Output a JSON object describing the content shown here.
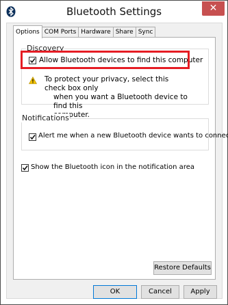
{
  "window": {
    "title": "Bluetooth Settings",
    "close_glyph": "✕"
  },
  "tabs": [
    "Options",
    "COM Ports",
    "Hardware",
    "Share",
    "Sync"
  ],
  "discovery": {
    "legend": "Discovery",
    "allow_label": "Allow Bluetooth devices to find this computer",
    "allow_checked": true,
    "warning_lines": [
      "To protect your privacy, select this check box only",
      "when you want a Bluetooth device to find this",
      "computer."
    ]
  },
  "notifications": {
    "legend": "Notifications",
    "alert_label": "Alert me when a new Bluetooth device wants to connect",
    "alert_checked": true
  },
  "show_icon": {
    "label": "Show the Bluetooth icon in the notification area",
    "checked": true
  },
  "buttons": {
    "restore_defaults": "Restore Defaults",
    "ok": "OK",
    "cancel": "Cancel",
    "apply": "Apply"
  },
  "colors": {
    "highlight": "#e51c23",
    "close_button": "#c75050",
    "warning": "#f2c200"
  },
  "icons": {
    "title": "bluetooth-icon",
    "warning": "warning-icon",
    "close": "close-icon"
  }
}
